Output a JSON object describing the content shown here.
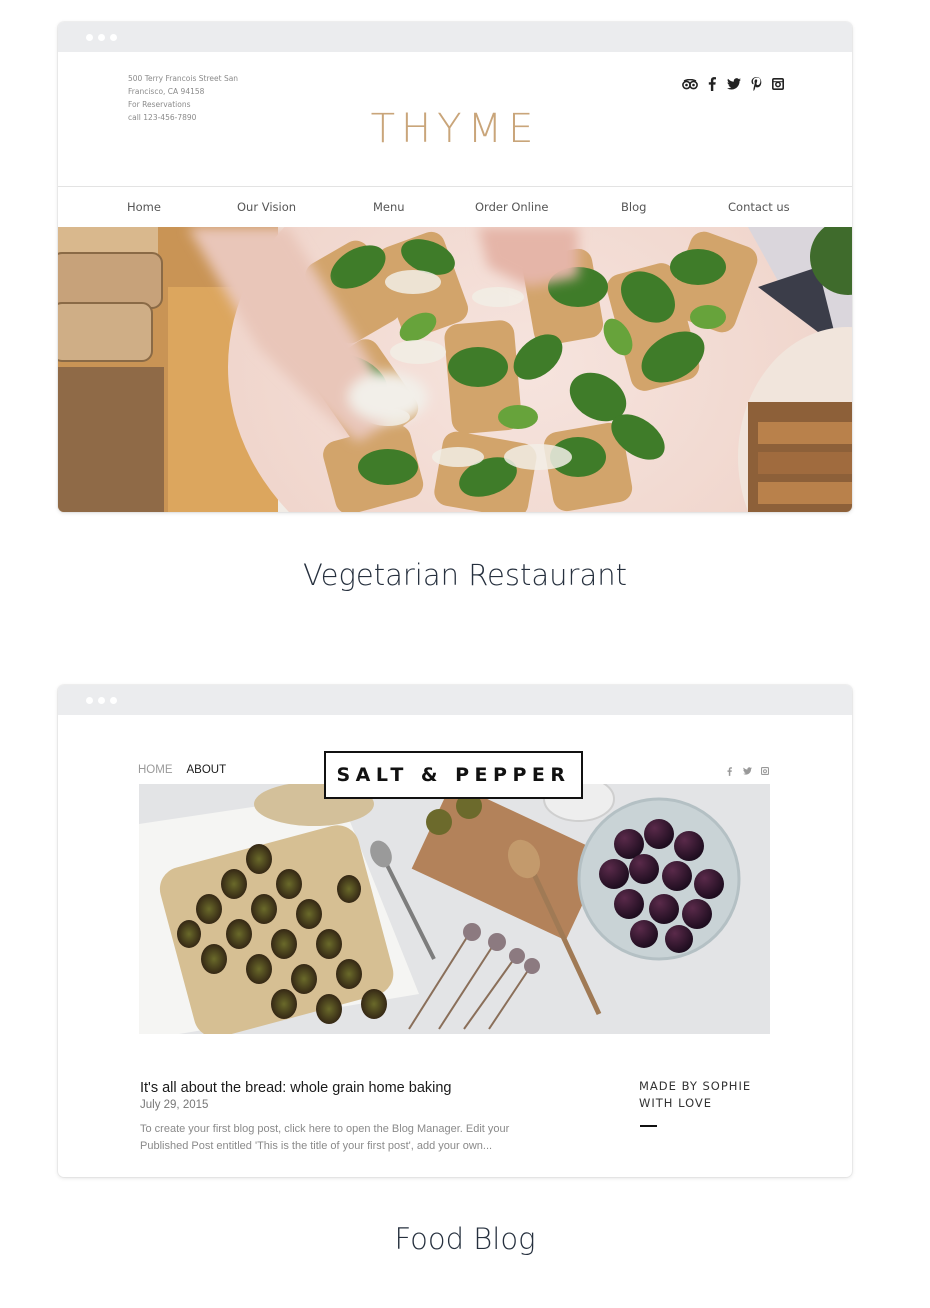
{
  "cards": [
    {
      "site": {
        "address_lines": [
          "500 Terry Francois Street San",
          "Francisco, CA 94158",
          "For Reservations",
          "call 123-456-7890"
        ],
        "logo": "THYME",
        "social_icons": [
          "tripadvisor-icon",
          "facebook-icon",
          "twitter-icon",
          "pinterest-icon",
          "instagram-icon"
        ],
        "nav": [
          "Home",
          "Our Vision",
          "Menu",
          "Order Online",
          "Blog",
          "Contact us"
        ]
      },
      "caption": "Vegetarian Restaurant"
    },
    {
      "site": {
        "nav": [
          "HOME",
          "ABOUT"
        ],
        "logo": "SALT & PEPPER",
        "social_icons": [
          "facebook-icon",
          "twitter-icon",
          "instagram-icon"
        ],
        "post": {
          "title": "It's all about the bread: whole grain home baking",
          "date": "July 29, 2015",
          "excerpt": "To create your first blog post, click here to open the Blog Manager.  Edit your Published Post entitled 'This is the title of your first post', add your own..."
        },
        "sidebar": {
          "line1": "MADE BY SOPHIE",
          "line2": "WITH LOVE"
        }
      },
      "caption": "Food Blog"
    }
  ],
  "colors": {
    "thyme_logo": "#c9a57a",
    "browser_bar": "#ebecee",
    "caption_text": "#26303e"
  }
}
